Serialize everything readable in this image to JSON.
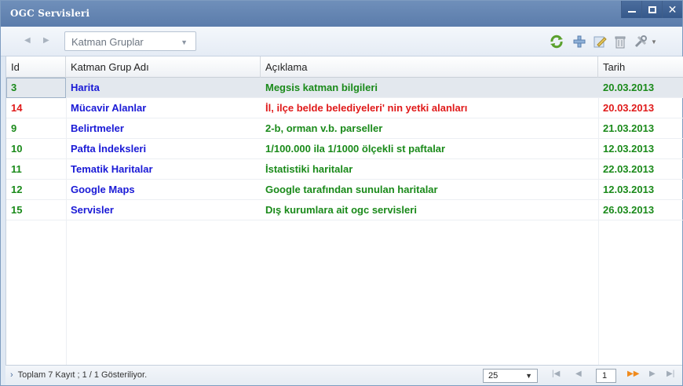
{
  "window": {
    "title": "OGC Servisleri",
    "controls": {
      "minimize": "minimize",
      "maximize": "maximize",
      "close": "✕"
    }
  },
  "toolbar": {
    "combo_label": "Katman Gruplar",
    "icons": [
      "refresh-icon",
      "add-icon",
      "edit-icon",
      "delete-icon",
      "tools-icon"
    ]
  },
  "grid": {
    "columns": [
      "Id",
      "Katman Grup Adı",
      "Açıklama",
      "Tarih"
    ],
    "rows": [
      {
        "id": "3",
        "name": "Harita",
        "desc": "Megsis katman bilgileri",
        "date": "20.03.2013",
        "color": "#1a8a1a",
        "name_color": "#1a1ad6"
      },
      {
        "id": "14",
        "name": "Mücavir Alanlar",
        "desc": "İl, ilçe belde belediyeleri' nin yetki alanları",
        "date": "20.03.2013",
        "color": "#e01a1a",
        "name_color": "#1a1ad6"
      },
      {
        "id": "9",
        "name": "Belirtmeler",
        "desc": "2-b, orman v.b. parseller",
        "date": "21.03.2013",
        "color": "#1a8a1a",
        "name_color": "#1a1ad6"
      },
      {
        "id": "10",
        "name": "Pafta İndeksleri",
        "desc": "1/100.000 ila 1/1000 ölçekli st paftalar",
        "date": "12.03.2013",
        "color": "#1a8a1a",
        "name_color": "#1a1ad6"
      },
      {
        "id": "11",
        "name": "Tematik Haritalar",
        "desc": "İstatistiki haritalar",
        "date": "22.03.2013",
        "color": "#1a8a1a",
        "name_color": "#1a1ad6"
      },
      {
        "id": "12",
        "name": "Google Maps",
        "desc": "Google tarafından sunulan haritalar",
        "date": "12.03.2013",
        "color": "#1a8a1a",
        "name_color": "#1a1ad6"
      },
      {
        "id": "15",
        "name": "Servisler",
        "desc": "Dış kurumlara ait ogc servisleri",
        "date": "26.03.2013",
        "color": "#1a8a1a",
        "name_color": "#1a1ad6"
      }
    ]
  },
  "pager": {
    "status": "Toplam 7 Kayıt ; 1 / 1 Gösteriliyor.",
    "page_size": "25",
    "page": "1"
  },
  "colors": {
    "titlebar": "#5b7cab",
    "accent_green": "#1a8a1a",
    "accent_red": "#e01a1a",
    "link_blue": "#1a1ad6"
  }
}
